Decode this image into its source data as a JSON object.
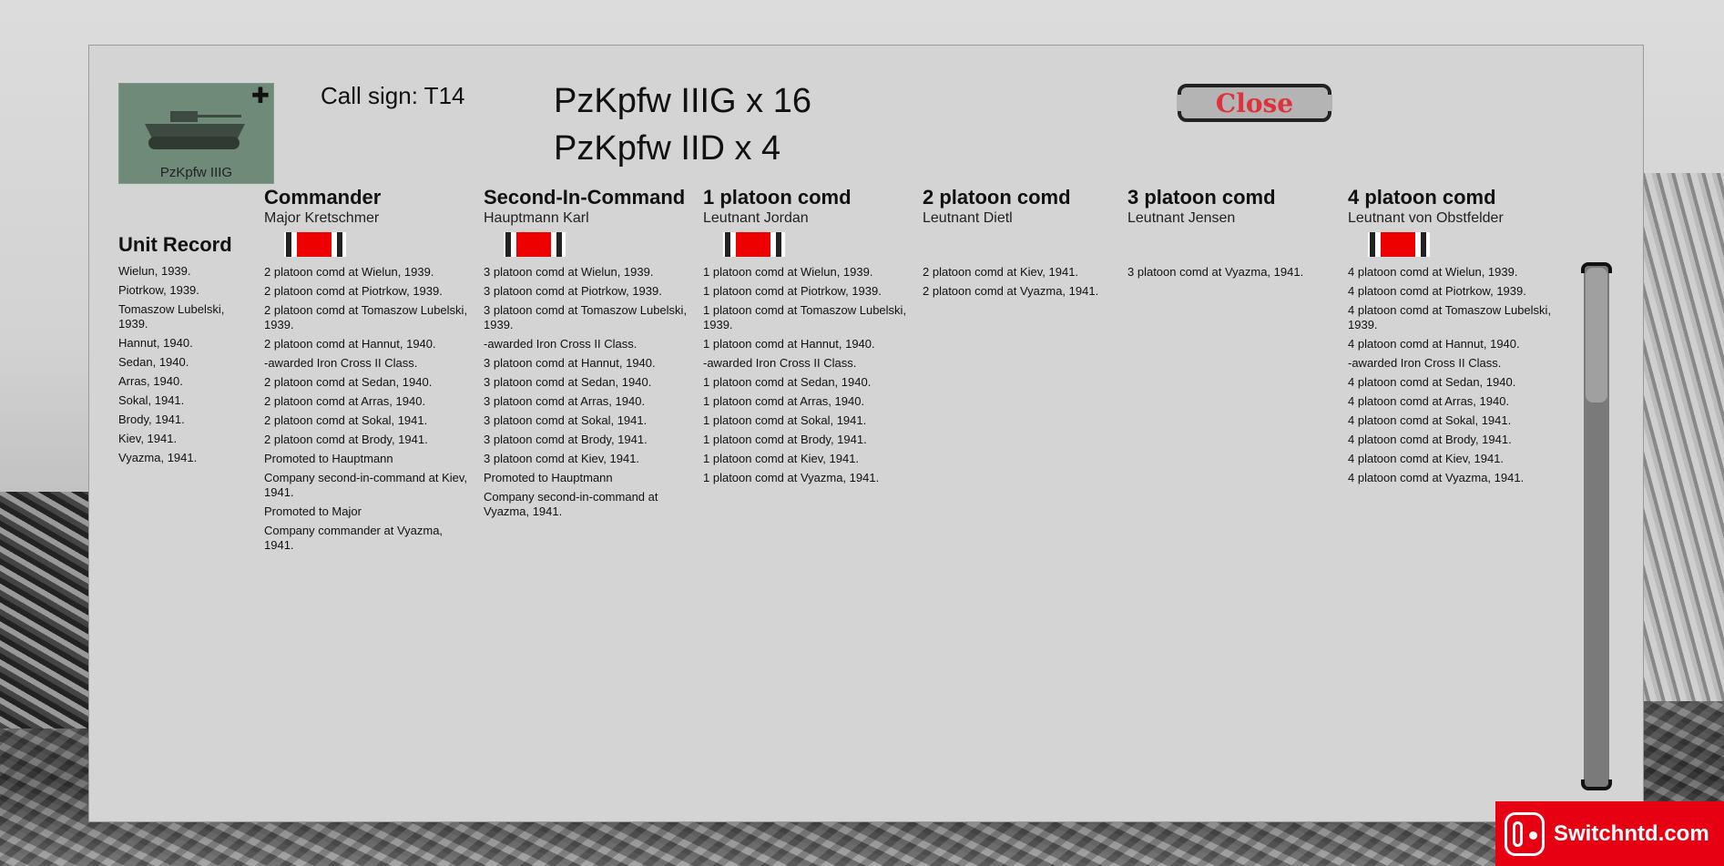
{
  "header": {
    "image_label": "PzKpfw IIIG",
    "call_sign": "Call sign: T14",
    "units": [
      "PzKpfw IIIG x 16",
      "PzKpfw IID x 4"
    ],
    "close_label": "Close"
  },
  "unit_record": {
    "title": "Unit Record",
    "entries": [
      "Wielun, 1939.",
      "Piotrkow, 1939.",
      "Tomaszow Lubelski, 1939.",
      "Hannut, 1940.",
      "Sedan, 1940.",
      "Arras, 1940.",
      "Sokal, 1941.",
      "Brody, 1941.",
      "Kiev, 1941.",
      "Vyazma, 1941."
    ]
  },
  "officers": [
    {
      "title": "Commander",
      "name": "Major Kretschmer",
      "decorated": true,
      "entries": [
        "2 platoon comd at Wielun, 1939.",
        "2 platoon comd at Piotrkow, 1939.",
        "2 platoon comd at Tomaszow Lubelski, 1939.",
        "2 platoon comd at Hannut, 1940.",
        "-awarded Iron Cross II Class.",
        "2 platoon comd at Sedan, 1940.",
        "2 platoon comd at Arras, 1940.",
        "2 platoon comd at Sokal, 1941.",
        "2 platoon comd at Brody, 1941.",
        "Promoted to Hauptmann",
        "Company second-in-command at Kiev, 1941.",
        "Promoted to Major",
        "Company commander at Vyazma, 1941."
      ]
    },
    {
      "title": "Second-In-Command",
      "name": "Hauptmann Karl",
      "decorated": true,
      "entries": [
        "3 platoon comd at Wielun, 1939.",
        "3 platoon comd at Piotrkow, 1939.",
        "3 platoon comd at Tomaszow Lubelski, 1939.",
        "-awarded Iron Cross II Class.",
        "3 platoon comd at Hannut, 1940.",
        "3 platoon comd at Sedan, 1940.",
        "3 platoon comd at Arras, 1940.",
        "3 platoon comd at Sokal, 1941.",
        "3 platoon comd at Brody, 1941.",
        "3 platoon comd at Kiev, 1941.",
        "Promoted to Hauptmann",
        "Company second-in-command at Vyazma, 1941."
      ]
    },
    {
      "title": "1 platoon comd",
      "name": "Leutnant Jordan",
      "decorated": true,
      "entries": [
        "1 platoon comd at Wielun, 1939.",
        "1 platoon comd at Piotrkow, 1939.",
        "1 platoon comd at Tomaszow Lubelski, 1939.",
        "1 platoon comd at Hannut, 1940.",
        "-awarded Iron Cross II Class.",
        "1 platoon comd at Sedan, 1940.",
        "1 platoon comd at Arras, 1940.",
        "1 platoon comd at Sokal, 1941.",
        "1 platoon comd at Brody, 1941.",
        "1 platoon comd at Kiev, 1941.",
        "1 platoon comd at Vyazma, 1941."
      ]
    },
    {
      "title": "2 platoon comd",
      "name": "Leutnant Dietl",
      "decorated": false,
      "entries": [
        "2 platoon comd at Kiev, 1941.",
        "2 platoon comd at Vyazma, 1941."
      ]
    },
    {
      "title": "3 platoon comd",
      "name": "Leutnant Jensen",
      "decorated": false,
      "entries": [
        "3 platoon comd at Vyazma, 1941."
      ]
    },
    {
      "title": "4 platoon comd",
      "name": "Leutnant von Obstfelder",
      "decorated": true,
      "entries": [
        "4 platoon comd at Wielun, 1939.",
        "4 platoon comd at Piotrkow, 1939.",
        "4 platoon comd at Tomaszow Lubelski, 1939.",
        "4 platoon comd at Hannut, 1940.",
        "-awarded Iron Cross II Class.",
        "4 platoon comd at Sedan, 1940.",
        "4 platoon comd at Arras, 1940.",
        "4 platoon comd at Sokal, 1941.",
        "4 platoon comd at Brody, 1941.",
        "4 platoon comd at Kiev, 1941.",
        "4 platoon comd at Vyazma, 1941."
      ]
    }
  ],
  "watermark": {
    "text": "Switchntd.com"
  },
  "colors": {
    "panel": "#d4d4d4",
    "close_text": "#e0303a",
    "ribbon_red": "#e00000",
    "watermark": "#e60012"
  }
}
